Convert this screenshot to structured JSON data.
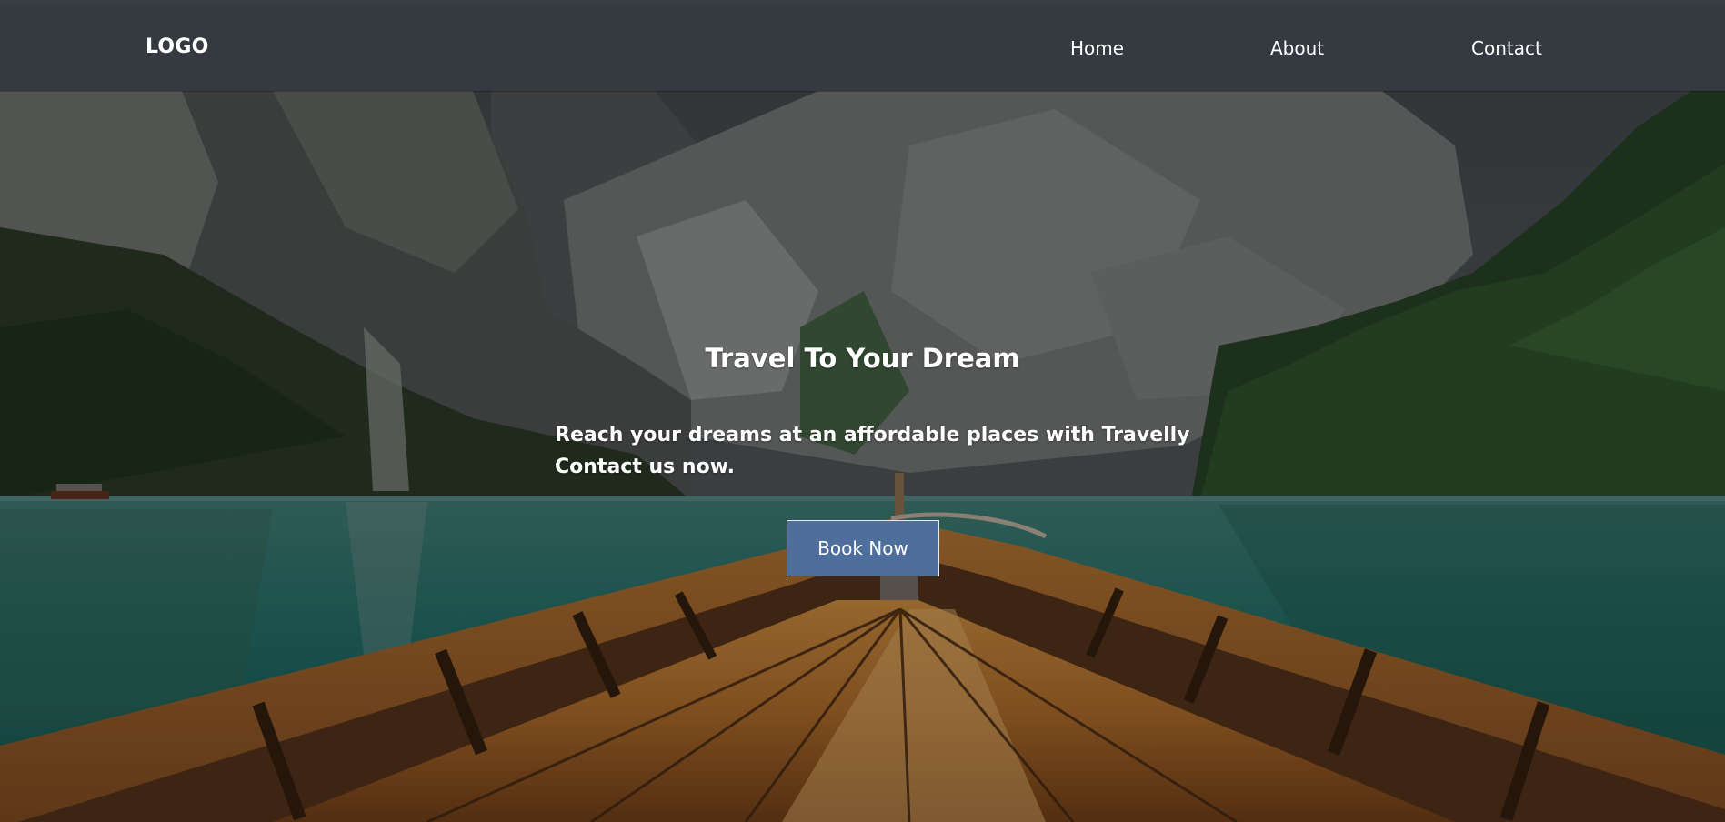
{
  "nav": {
    "logo": "LOGO",
    "links": [
      "Home",
      "About",
      "Contact"
    ]
  },
  "hero": {
    "title": "Travel To Your Dream",
    "subtitle": "Reach your dreams at an affordable places with Travelly Contact us now.",
    "button_label": "Book Now"
  },
  "colors": {
    "navbar_bg": "#343a40",
    "button_bg": "#4e6e9b",
    "text": "#ffffff"
  }
}
